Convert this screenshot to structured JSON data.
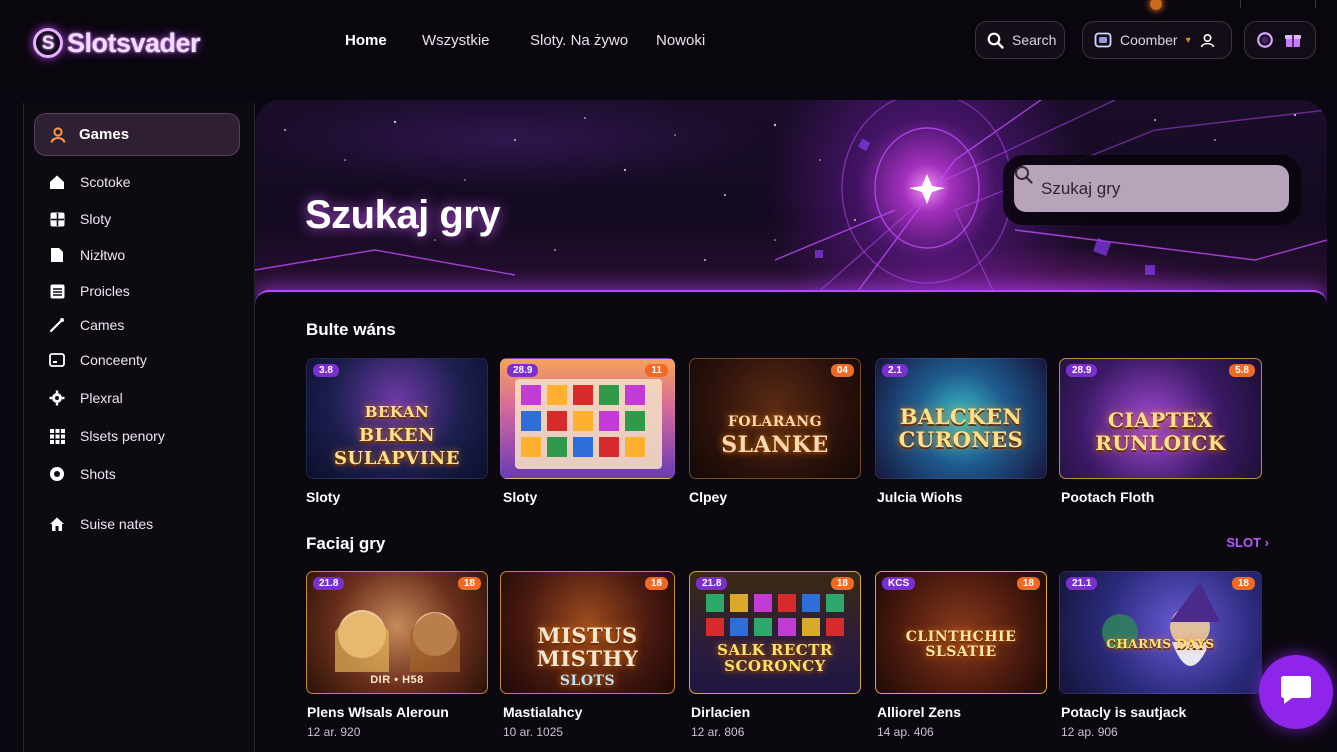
{
  "brand": {
    "name": "Slotsvader",
    "mark": "S",
    "accent": "#b449ff"
  },
  "topnav": {
    "items": [
      "Home",
      "Wszystkie",
      "Sloty. Na żywo",
      "Nowoki"
    ],
    "active": "Home"
  },
  "header": {
    "search_label": "Search",
    "account_label": "Coomber",
    "search_icon": "search-icon",
    "account_icon": "wallet-icon",
    "user_icon": "user-icon"
  },
  "sidebar": {
    "active": {
      "label": "Games",
      "icon": "user-icon"
    },
    "items": [
      {
        "label": "Scotoke",
        "icon": "home-icon"
      },
      {
        "label": "Sloty",
        "icon": "grid-icon"
      },
      {
        "label": "Nizłtwo",
        "icon": "page-icon"
      },
      {
        "label": "Proicles",
        "icon": "list-icon"
      },
      {
        "label": "Cames",
        "icon": "dice-icon"
      },
      {
        "label": "Conceenty",
        "icon": "tv-icon"
      },
      {
        "label": "Plexral",
        "icon": "gear-icon"
      },
      {
        "label": "Slsets penory",
        "icon": "apps-icon"
      },
      {
        "label": "Shots",
        "icon": "target-icon"
      },
      {
        "label": "Suise nates",
        "icon": "house-icon"
      }
    ]
  },
  "hero": {
    "title": "Szukaj gry",
    "search_placeholder": "Szukaj gry"
  },
  "sections": [
    {
      "title": "Bulte wáns",
      "games": [
        {
          "name": "Sloty",
          "badge_left": "3.8",
          "badge_right": "",
          "art": "BLKEN SULAPVINE",
          "art_top": "BEKAN",
          "theme": "blue"
        },
        {
          "name": "Sloty",
          "badge_left": "28.9",
          "badge_right": "11",
          "art": "",
          "art_top": "",
          "theme": "slots"
        },
        {
          "name": "Clpey",
          "badge_left": "",
          "badge_right": "04",
          "art": "SLANKE",
          "art_top": "FOLARANG",
          "theme": "dark"
        },
        {
          "name": "Julcia Wiohs",
          "badge_left": "2.1",
          "badge_right": "",
          "art": "BALCKEN CURONES",
          "art_top": "",
          "theme": "teal"
        },
        {
          "name": "Pootach Floth",
          "badge_left": "28.9",
          "badge_right": "5.8",
          "art": "CIAPTEX RUNLOICK",
          "art_top": "",
          "theme": "gems"
        }
      ]
    },
    {
      "title": "Faciaj gry",
      "see_all": "SLOT ›",
      "games": [
        {
          "name": "Plens Włsals Aleroun",
          "meta": "12 ar. 920",
          "badge_left": "21.8",
          "badge_right": "18",
          "art": "DIR • H58",
          "art_top": "",
          "theme": "ladies"
        },
        {
          "name": "Mastialahcy",
          "meta": "10 ar. 1025",
          "badge_left": "",
          "badge_right": "18",
          "art": "MISTUS MISTHY",
          "art_top": "SLOTS",
          "theme": "tomb"
        },
        {
          "name": "Dirlacien",
          "meta": "12 ar. 806",
          "badge_left": "21.8",
          "badge_right": "18",
          "art": "SALK RECTR SCORONCY",
          "art_top": "",
          "theme": "gems2"
        },
        {
          "name": "Alliorel Zens",
          "meta": "14 ap. 406",
          "badge_left": "KCS",
          "badge_right": "18",
          "art": "CLINTHCHIE SLSATIE",
          "art_top": "",
          "theme": "gold"
        },
        {
          "name": "Potacly is sautjack",
          "meta": "12 ap. 906",
          "badge_left": "21.1",
          "badge_right": "18",
          "art": "CHARMS DAYS",
          "art_top": "",
          "theme": "wizard"
        }
      ]
    }
  ],
  "chat": {
    "icon": "chat-icon"
  }
}
